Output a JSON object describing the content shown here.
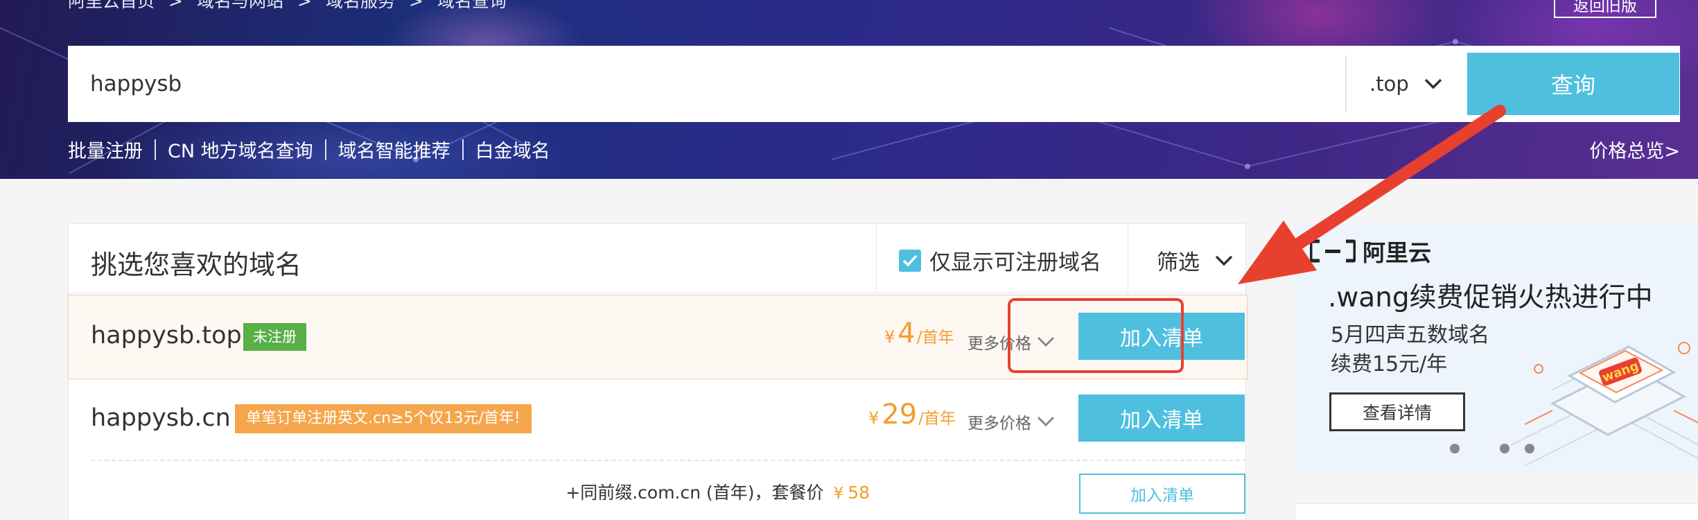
{
  "breadcrumb": {
    "items": [
      "阿里云首页",
      "域名与网站",
      "域名服务",
      "域名查询"
    ],
    "separator": ">"
  },
  "header": {
    "back_old_label": "返回旧版"
  },
  "search": {
    "value": "happysb",
    "tld": ".top",
    "button_label": "查询"
  },
  "sublinks": {
    "items": [
      "批量注册",
      "CN 地方域名查询",
      "域名智能推荐",
      "白金域名"
    ],
    "price_overview": "价格总览>"
  },
  "results": {
    "title": "挑选您喜欢的域名",
    "filter_available_label": "仅显示可注册域名",
    "filter_available_checked": true,
    "filter_label": "筛选",
    "rows": [
      {
        "domain": "happysb.top",
        "badge": "未注册",
        "currency": "¥",
        "price": "4",
        "unit": "/首年",
        "more_prices": "更多价格",
        "add_label": "加入清单"
      },
      {
        "domain": "happysb.cn",
        "badge": "单笔订单注册英文.cn≥5个仅13元/首年!",
        "currency": "¥",
        "price": "29",
        "unit": "/首年",
        "more_prices": "更多价格",
        "add_label": "加入清单"
      }
    ],
    "bundle": {
      "text": "+同前缀.com.cn (首年)，套餐价",
      "currency": "¥",
      "price": "58",
      "add_label": "加入清单"
    }
  },
  "ad": {
    "brand": "阿里云",
    "headline": ".wang续费促销火热进行中",
    "line1": "5月四声五数域名",
    "line2": "续费15元/年",
    "button_label": "查看详情",
    "illustration_text": "wang"
  },
  "colors": {
    "accent": "#4fbfe0",
    "price": "#f39c2c",
    "badge_green": "#58b047",
    "badge_orange": "#f5a64c",
    "annotation_red": "#e8402f"
  }
}
